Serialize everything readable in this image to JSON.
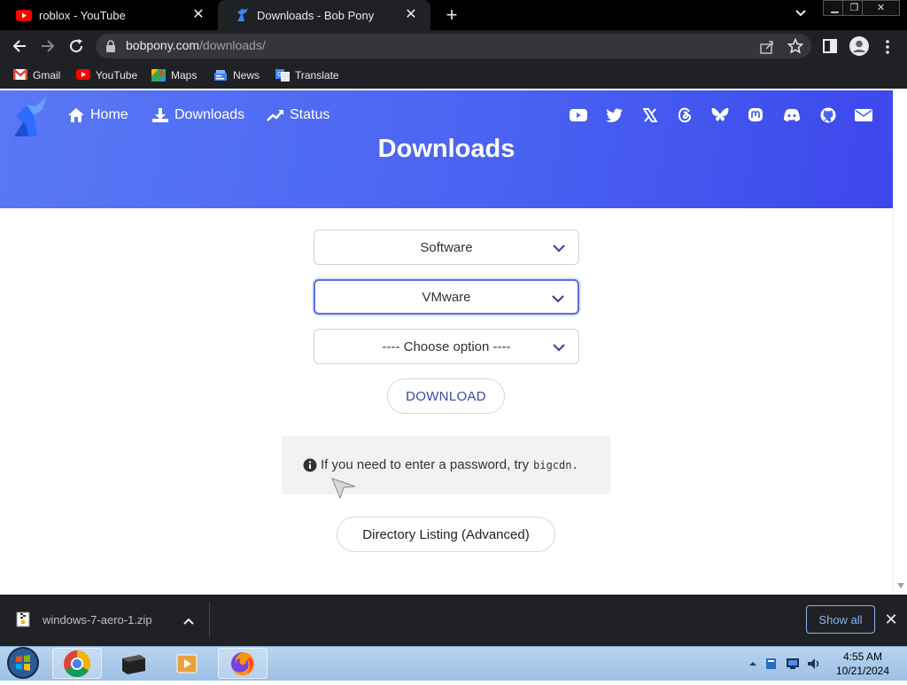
{
  "browser": {
    "tabs": [
      {
        "title": "roblox - YouTube",
        "icon": "youtube-icon"
      },
      {
        "title": "Downloads - Bob Pony",
        "icon": "bobpony-icon",
        "active": true
      }
    ],
    "url_host": "bobpony.com",
    "url_path": "/downloads/",
    "bookmarks": [
      {
        "label": "Gmail",
        "icon": "gmail-icon"
      },
      {
        "label": "YouTube",
        "icon": "youtube-icon"
      },
      {
        "label": "Maps",
        "icon": "maps-icon"
      },
      {
        "label": "News",
        "icon": "news-icon"
      },
      {
        "label": "Translate",
        "icon": "translate-icon"
      }
    ]
  },
  "site": {
    "nav": [
      {
        "label": "Home",
        "icon": "home-icon"
      },
      {
        "label": "Downloads",
        "icon": "download-icon"
      },
      {
        "label": "Status",
        "icon": "trending-up-icon"
      }
    ],
    "socials": [
      "youtube",
      "twitter",
      "x",
      "threads",
      "bluesky",
      "mastodon",
      "discord",
      "github",
      "email"
    ],
    "accent_color": "#4a63f2",
    "page_title": "Downloads"
  },
  "form": {
    "category_select": "Software",
    "product_select": "VMware",
    "version_select": "---- Choose option ----",
    "download_label": "DOWNLOAD",
    "notice_text": "If you need to enter a password, try",
    "notice_code": "bigcdn.",
    "directory_listing_label": "Directory Listing (Advanced)"
  },
  "download_shelf": {
    "file_name": "windows-7-aero-1.zip",
    "show_all_label": "Show all"
  },
  "taskbar": {
    "apps": [
      "chrome",
      "terminal",
      "media-player",
      "firefox"
    ],
    "time": "4:55 AM",
    "date": "10/21/2024"
  }
}
